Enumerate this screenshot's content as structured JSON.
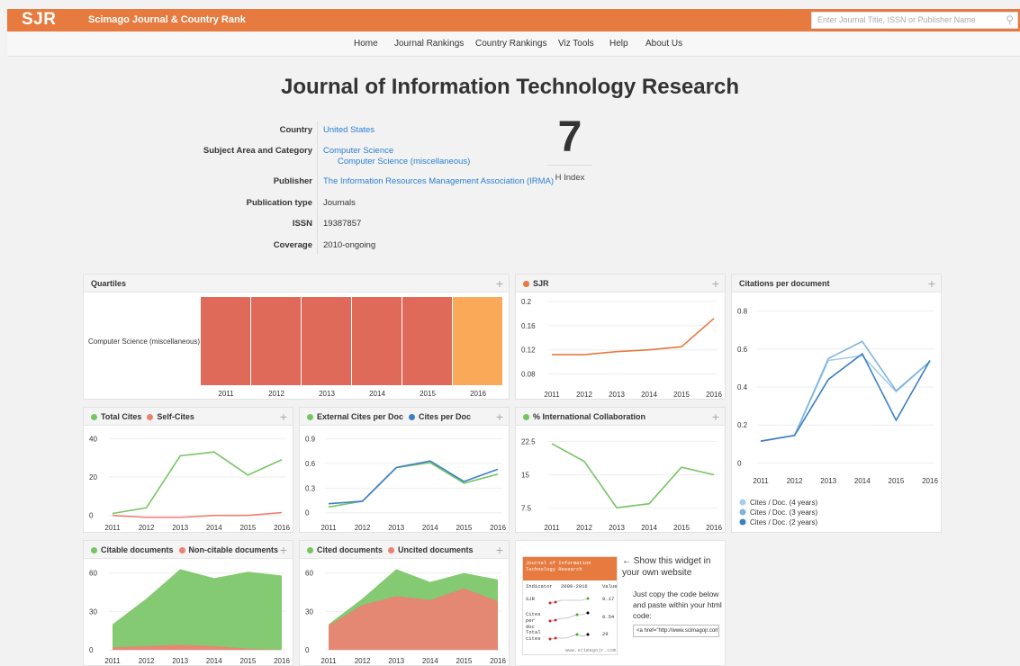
{
  "header": {
    "logo": "SJR",
    "brand": "Scimago Journal & Country Rank",
    "search_placeholder": "Enter Journal Title, ISSN or Publisher Name"
  },
  "nav": [
    "Home",
    "Journal Rankings",
    "Country Rankings",
    "Viz Tools",
    "Help",
    "About Us"
  ],
  "title": "Journal of Information Technology Research",
  "info": {
    "country_label": "Country",
    "country": "United States",
    "subject_label": "Subject Area and Category",
    "subject": "Computer Science",
    "category": "Computer Science (miscellaneous)",
    "publisher_label": "Publisher",
    "publisher": "The Information Resources Management Association (IRMA)",
    "pubtype_label": "Publication type",
    "pubtype": "Journals",
    "issn_label": "ISSN",
    "issn": "19387857",
    "coverage_label": "Coverage",
    "coverage": "2010-ongoing"
  },
  "hindex": {
    "value": "7",
    "label": "H Index"
  },
  "colors": {
    "accent": "#e67a3f",
    "green": "#77c463",
    "red": "#ee7f73",
    "blue": "#3b7fc4",
    "lightblue": "#a6cdef",
    "midblue": "#7fb3e0",
    "quart_red": "#e06a5a",
    "quart_orange": "#f9a957"
  },
  "panels": {
    "quartiles": {
      "title": "Quartiles",
      "plus": "+"
    },
    "sjr": {
      "title": "SJR",
      "plus": "+"
    },
    "cpd": {
      "title": "Citations per document",
      "plus": "+"
    },
    "cites": {
      "title_a": "Total Cites",
      "title_b": "Self-Cites",
      "plus": "+"
    },
    "ext": {
      "title_a": "External Cites per Doc",
      "title_b": "Cites per Doc",
      "plus": "+"
    },
    "intl": {
      "title": "% International Collaboration",
      "plus": "+"
    },
    "citable": {
      "title_a": "Citable documents",
      "title_b": "Non-citable documents",
      "plus": "+"
    },
    "cited": {
      "title_a": "Cited documents",
      "title_b": "Uncited documents",
      "plus": "+"
    }
  },
  "chart_data": [
    {
      "id": "quartiles",
      "type": "heatmap",
      "category": "Computer Science (miscellaneous)",
      "years": [
        "2011",
        "2012",
        "2013",
        "2014",
        "2015",
        "2016"
      ],
      "quartiles": [
        "Q4",
        "Q4",
        "Q4",
        "Q4",
        "Q4",
        "Q3"
      ]
    },
    {
      "id": "sjr",
      "type": "line",
      "x": [
        "2011",
        "2012",
        "2013",
        "2014",
        "2015",
        "2016"
      ],
      "yticks": [
        "0.2",
        "0.16",
        "0.12",
        "0.08"
      ],
      "ylim": [
        0.06,
        0.2
      ],
      "series": [
        {
          "values": [
            0.112,
            0.112,
            0.117,
            0.12,
            0.125,
            0.172
          ]
        }
      ]
    },
    {
      "id": "cpd",
      "type": "line",
      "x": [
        "2011",
        "2012",
        "2013",
        "2014",
        "2015",
        "2016"
      ],
      "yticks": [
        "0.8",
        "0.6",
        "0.4",
        "0.2",
        "0"
      ],
      "ylim": [
        -0.05,
        0.85
      ],
      "series": [
        {
          "name": "Cites / Doc. (4 years)",
          "values": [
            0.115,
            0.145,
            0.54,
            0.565,
            0.375,
            0.535
          ]
        },
        {
          "name": "Cites / Doc. (3 years)",
          "values": [
            0.115,
            0.145,
            0.55,
            0.64,
            0.38,
            0.535
          ]
        },
        {
          "name": "Cites / Doc. (2 years)",
          "values": [
            0.115,
            0.145,
            0.44,
            0.575,
            0.225,
            0.54
          ]
        }
      ]
    },
    {
      "id": "cites",
      "type": "line",
      "x": [
        "2011",
        "2012",
        "2013",
        "2014",
        "2015",
        "2016"
      ],
      "yticks": [
        "40",
        "20",
        "0"
      ],
      "ylim": [
        -2,
        42
      ],
      "series": [
        {
          "name": "Total Cites",
          "values": [
            1,
            4,
            31,
            33,
            21,
            29
          ]
        },
        {
          "name": "Self-Cites",
          "values": [
            0,
            -1,
            -1,
            0,
            0,
            1.5
          ]
        }
      ]
    },
    {
      "id": "ext",
      "type": "line",
      "x": [
        "2011",
        "2012",
        "2013",
        "2014",
        "2015",
        "2016"
      ],
      "yticks": [
        "0.9",
        "0.6",
        "0.3",
        "0"
      ],
      "ylim": [
        -0.08,
        0.95
      ],
      "series": [
        {
          "name": "External Cites per Doc",
          "values": [
            0.07,
            0.14,
            0.55,
            0.61,
            0.36,
            0.47
          ]
        },
        {
          "name": "Cites per Doc",
          "values": [
            0.11,
            0.14,
            0.55,
            0.63,
            0.38,
            0.53
          ]
        }
      ]
    },
    {
      "id": "intl",
      "type": "line",
      "x": [
        "2011",
        "2012",
        "2013",
        "2014",
        "2015",
        "2016"
      ],
      "yticks": [
        "22.5",
        "15",
        "7.5"
      ],
      "ylim": [
        5,
        24
      ],
      "series": [
        {
          "name": "% International Collaboration",
          "values": [
            22,
            18,
            7.6,
            8.5,
            16.7,
            15
          ]
        }
      ]
    },
    {
      "id": "citable",
      "type": "area",
      "x": [
        "2011",
        "2012",
        "2013",
        "2014",
        "2015",
        "2016"
      ],
      "yticks": [
        "60",
        "30",
        "0"
      ],
      "ylim": [
        -2,
        64
      ],
      "series": [
        {
          "name": "Citable documents",
          "values": [
            20,
            40,
            63,
            56,
            61,
            58
          ]
        },
        {
          "name": "Non-citable documents",
          "values": [
            2,
            3,
            4,
            3,
            1,
            0
          ]
        }
      ]
    },
    {
      "id": "cited",
      "type": "area",
      "x": [
        "2011",
        "2012",
        "2013",
        "2014",
        "2015",
        "2016"
      ],
      "yticks": [
        "60",
        "30",
        "0"
      ],
      "ylim": [
        -2,
        64
      ],
      "series": [
        {
          "name": "Cited documents",
          "values": [
            20,
            40,
            63,
            53,
            60,
            55
          ]
        },
        {
          "name": "Uncited documents",
          "values": [
            19,
            35,
            42,
            39,
            48,
            38
          ]
        }
      ]
    }
  ],
  "cpd_legend": [
    "Cites / Doc. (4 years)",
    "Cites / Doc. (3 years)",
    "Cites / Doc. (2 years)"
  ],
  "widget": {
    "journal": "Journal of Information Technology Research",
    "col_indicator": "Indicator",
    "col_years": "2009-2016",
    "col_value": "Value",
    "r1_label": "SJR",
    "r1_value": "0.17",
    "r2_label": "Cites per doc",
    "r2_value": "0.54",
    "r3_label": "Total cites",
    "r3_value": "29",
    "footer": "www.scimagojr.com",
    "arrow_text": "← Show this widget in your own website",
    "copy_text": "Just copy the code below and paste within your html code:",
    "code": "<a href=\"http://www.scimagojr.com"
  }
}
